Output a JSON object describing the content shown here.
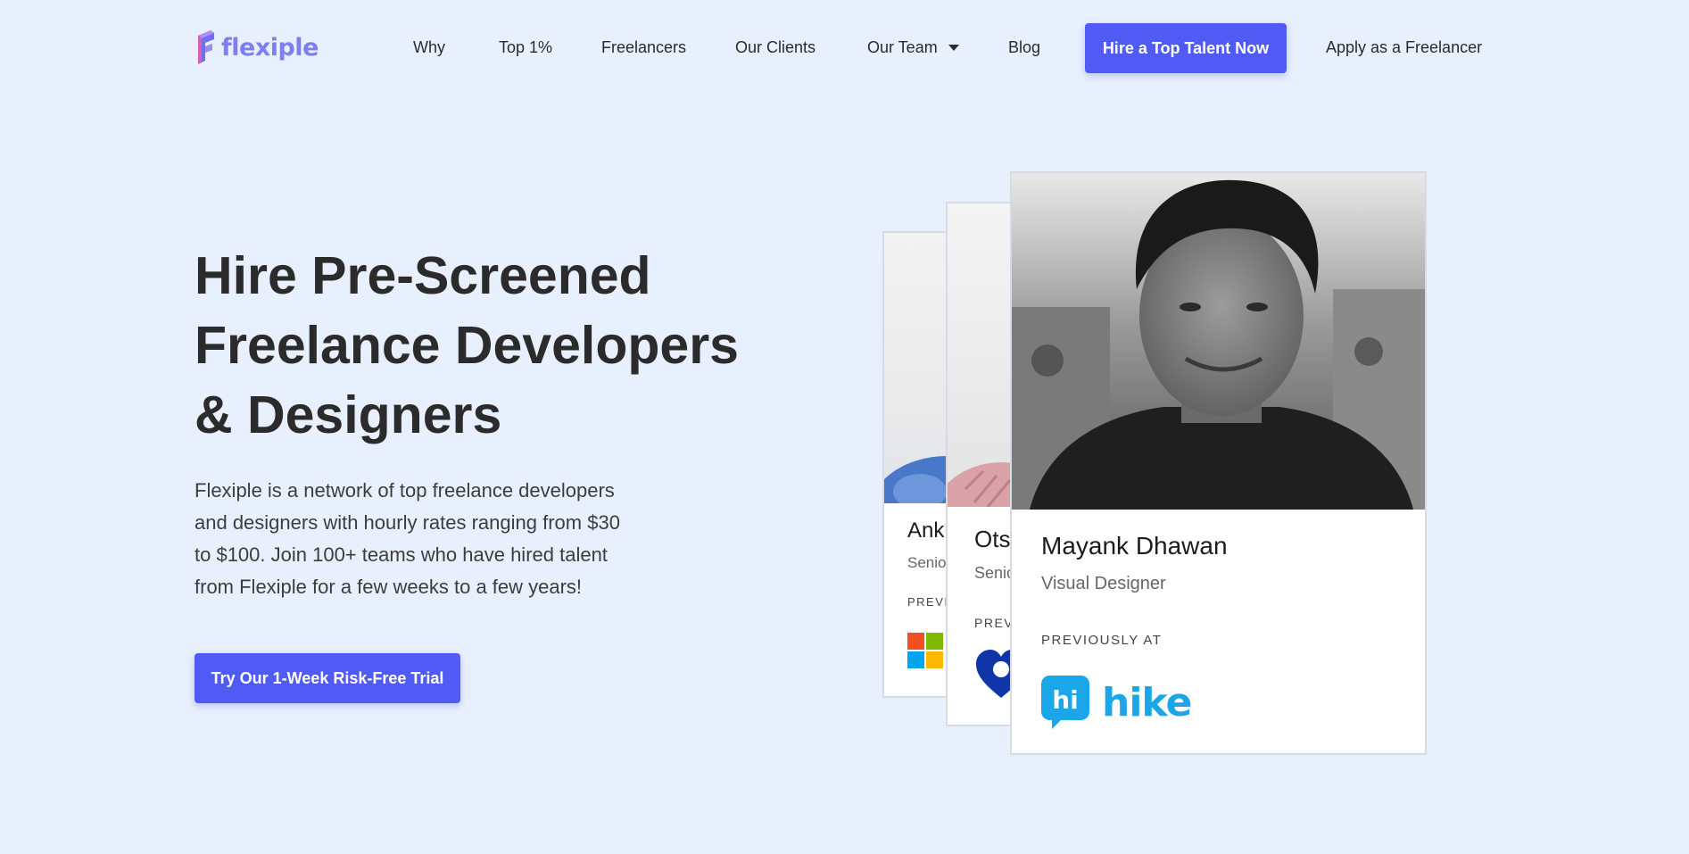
{
  "brand": {
    "name": "flexiple",
    "accent_color": "#4f5bf4",
    "logo_color": "#7d7ff0"
  },
  "nav": {
    "items": [
      {
        "label": "Why"
      },
      {
        "label": "Top 1%"
      },
      {
        "label": "Freelancers"
      },
      {
        "label": "Our Clients"
      },
      {
        "label": "Our Team",
        "has_dropdown": true,
        "icon": "chevron-down-icon"
      },
      {
        "label": "Blog"
      }
    ],
    "cta_label": "Hire a Top Talent Now",
    "apply_label": "Apply as a Freelancer"
  },
  "hero": {
    "title_lines": [
      "Hire Pre-Screened",
      "Freelance Developers",
      "& Designers"
    ],
    "description": "Flexiple is a network of top freelance developers and designers with hourly rates ranging from $30 to $100. Join 100+ teams who have hired talent from Flexiple for a few weeks to a few years!",
    "cta_label": "Try Our 1-Week Risk-Free Trial"
  },
  "cards": {
    "back1": {
      "name": "Anku",
      "role": "Senio",
      "previously_at": "PREVI",
      "company_icon": "microsoft-logo-icon"
    },
    "back2": {
      "name": "Ots",
      "role": "Senio",
      "previously_at": "PREV",
      "company_icon": "company-logo-icon"
    },
    "front": {
      "name": "Mayank Dhawan",
      "role": "Visual Designer",
      "previously_at": "PREVIOUSLY AT",
      "company": "hike",
      "company_icon": "hike-logo-icon",
      "company_color": "#1aa6e8"
    }
  }
}
